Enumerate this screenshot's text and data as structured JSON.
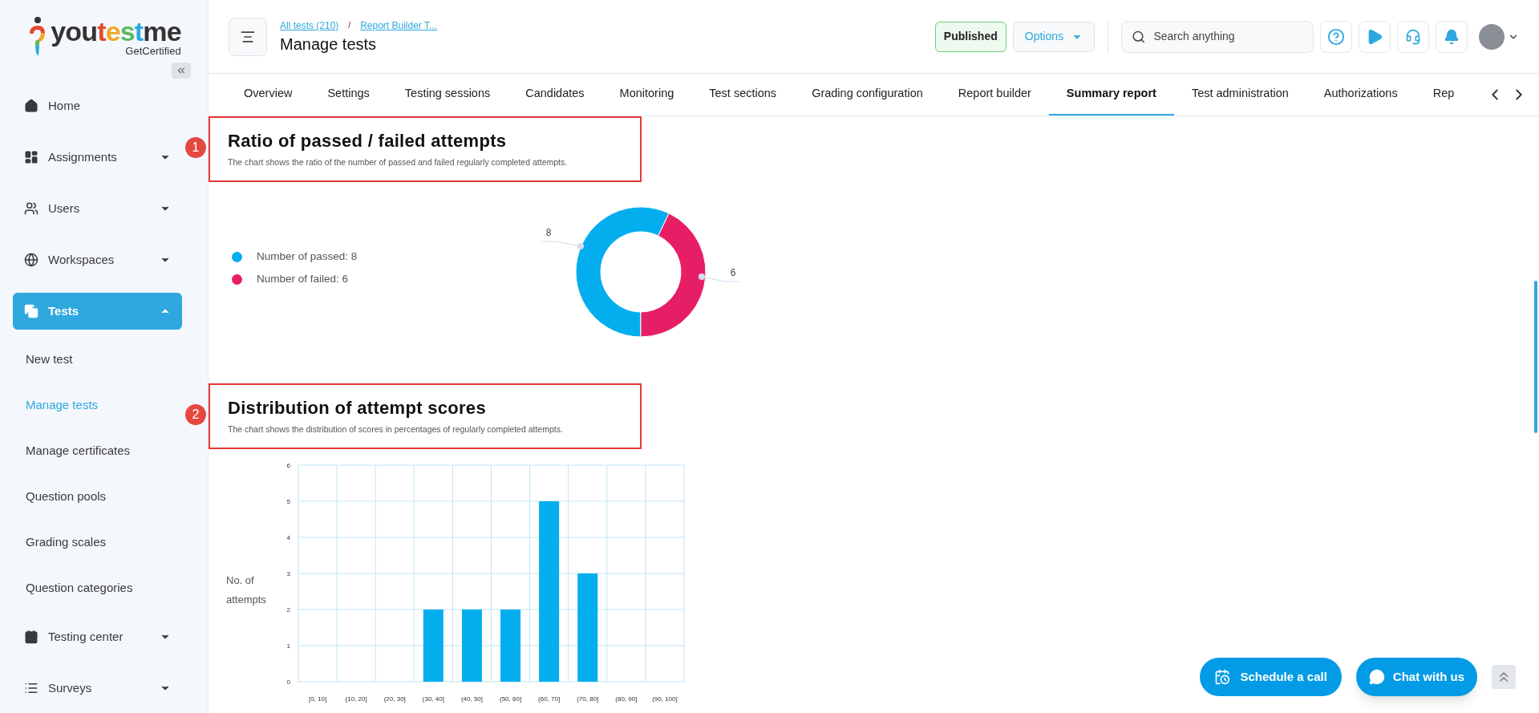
{
  "logo": {
    "parts": [
      {
        "text": "you",
        "color": "#333333"
      },
      {
        "text": "t",
        "color": "#e2492f"
      },
      {
        "text": "e",
        "color": "#f5a623"
      },
      {
        "text": "s",
        "color": "#5cb85c"
      },
      {
        "text": "t",
        "color": "#29a8e0"
      },
      {
        "text": "me",
        "color": "#333333"
      }
    ],
    "tagline": "GetCertified"
  },
  "sidebar": {
    "items": [
      {
        "label": "Home",
        "selected": false
      },
      {
        "label": "Assignments",
        "expanded": false,
        "selected": false
      },
      {
        "label": "Users",
        "expanded": false,
        "selected": false
      },
      {
        "label": "Workspaces",
        "expanded": false,
        "selected": false
      },
      {
        "label": "Tests",
        "expanded": true,
        "selected": true,
        "children": [
          {
            "label": "New test",
            "selected": false
          },
          {
            "label": "Manage tests",
            "selected": true
          },
          {
            "label": "Manage certificates",
            "selected": false
          },
          {
            "label": "Question pools",
            "selected": false
          },
          {
            "label": "Grading scales",
            "selected": false
          },
          {
            "label": "Question categories",
            "selected": false
          }
        ]
      },
      {
        "label": "Testing center",
        "expanded": false,
        "selected": false
      },
      {
        "label": "Surveys",
        "expanded": false,
        "selected": false
      }
    ]
  },
  "header": {
    "breadcrumbs": [
      "All tests (210)",
      "Report Builder T..."
    ],
    "breadcrumb_separator": "/",
    "title": "Manage tests",
    "status": "Published",
    "options_label": "Options",
    "search": {
      "placeholder": "Search anything"
    }
  },
  "tabs": [
    {
      "label": "Overview",
      "selected": false
    },
    {
      "label": "Settings",
      "selected": false
    },
    {
      "label": "Testing sessions",
      "selected": false
    },
    {
      "label": "Candidates",
      "selected": false
    },
    {
      "label": "Monitoring",
      "selected": false
    },
    {
      "label": "Test sections",
      "selected": false
    },
    {
      "label": "Grading configuration",
      "selected": false
    },
    {
      "label": "Report builder",
      "selected": false
    },
    {
      "label": "Summary report",
      "selected": true
    },
    {
      "label": "Test administration",
      "selected": false
    },
    {
      "label": "Authorizations",
      "selected": false
    },
    {
      "label": "Rep",
      "selected": false
    }
  ],
  "sections": [
    {
      "number": "1",
      "title": "Ratio of passed / failed attempts",
      "description": "The chart shows the ratio of the number of passed and failed regularly completed attempts.",
      "legend": [
        {
          "label": "Number of passed: 8",
          "color": "#03aeef"
        },
        {
          "label": "Number of failed: 6",
          "color": "#e61e66"
        }
      ],
      "chart_data": {
        "type": "donut",
        "values": [
          8,
          6
        ],
        "data_labels": true
      }
    },
    {
      "number": "2",
      "title": "Distribution of attempt scores",
      "description": "The chart shows the distribution of scores in percentages of regularly completed attempts.",
      "chart_data": {
        "type": "bar",
        "ylabel": "No. of attempts",
        "categories": [
          "[0, 10]",
          "(10, 20]",
          "(20, 30]",
          "(30, 40]",
          "(40, 50]",
          "(50, 60]",
          "(60, 70]",
          "(70, 80]",
          "(80, 90]",
          "(90, 100]"
        ],
        "series": [
          {
            "color": "#03aeef",
            "values": [
              0,
              0,
              0,
              2,
              2,
              2,
              5,
              3,
              0,
              0
            ]
          }
        ],
        "ylim": [
          0,
          6
        ],
        "yticks": [
          0,
          1,
          2,
          3,
          4,
          5,
          6
        ],
        "grid": true
      }
    }
  ],
  "floating": {
    "schedule": "Schedule a call",
    "chat": "Chat with us"
  }
}
